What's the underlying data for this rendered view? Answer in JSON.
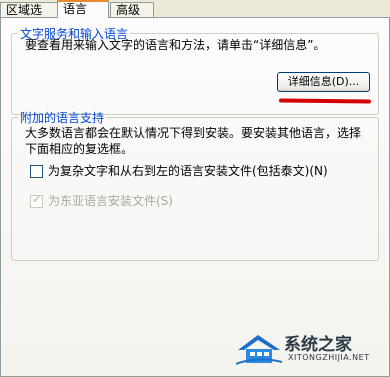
{
  "tabs": [
    {
      "label": "区域选项"
    },
    {
      "label": "语言"
    },
    {
      "label": "高级"
    }
  ],
  "text_services": {
    "title": "文字服务和输入语言",
    "description": "要查看用来输入文字的语言和方法，请单击“详细信息”。",
    "details_button": "详细信息(D)..."
  },
  "supplemental": {
    "title": "附加的语言支持",
    "description_line1": "大多数语言都会在默认情况下得到安装。要安装其他语言，选择",
    "description_line2": "下面相应的复选框。",
    "complex_script": {
      "label": "为复杂文字和从右到左的语言安装文件(包括泰文)(N)",
      "checked": false
    },
    "east_asian": {
      "label": "为东亚语言安装文件(S)",
      "checked": true,
      "disabled": true
    }
  },
  "watermark": {
    "title": "系统之家",
    "url": "XITONGZHIJIA.NET"
  },
  "colors": {
    "annotation": "#d40000",
    "group_title": "#0046d5",
    "disabled_text": "#aca899"
  }
}
